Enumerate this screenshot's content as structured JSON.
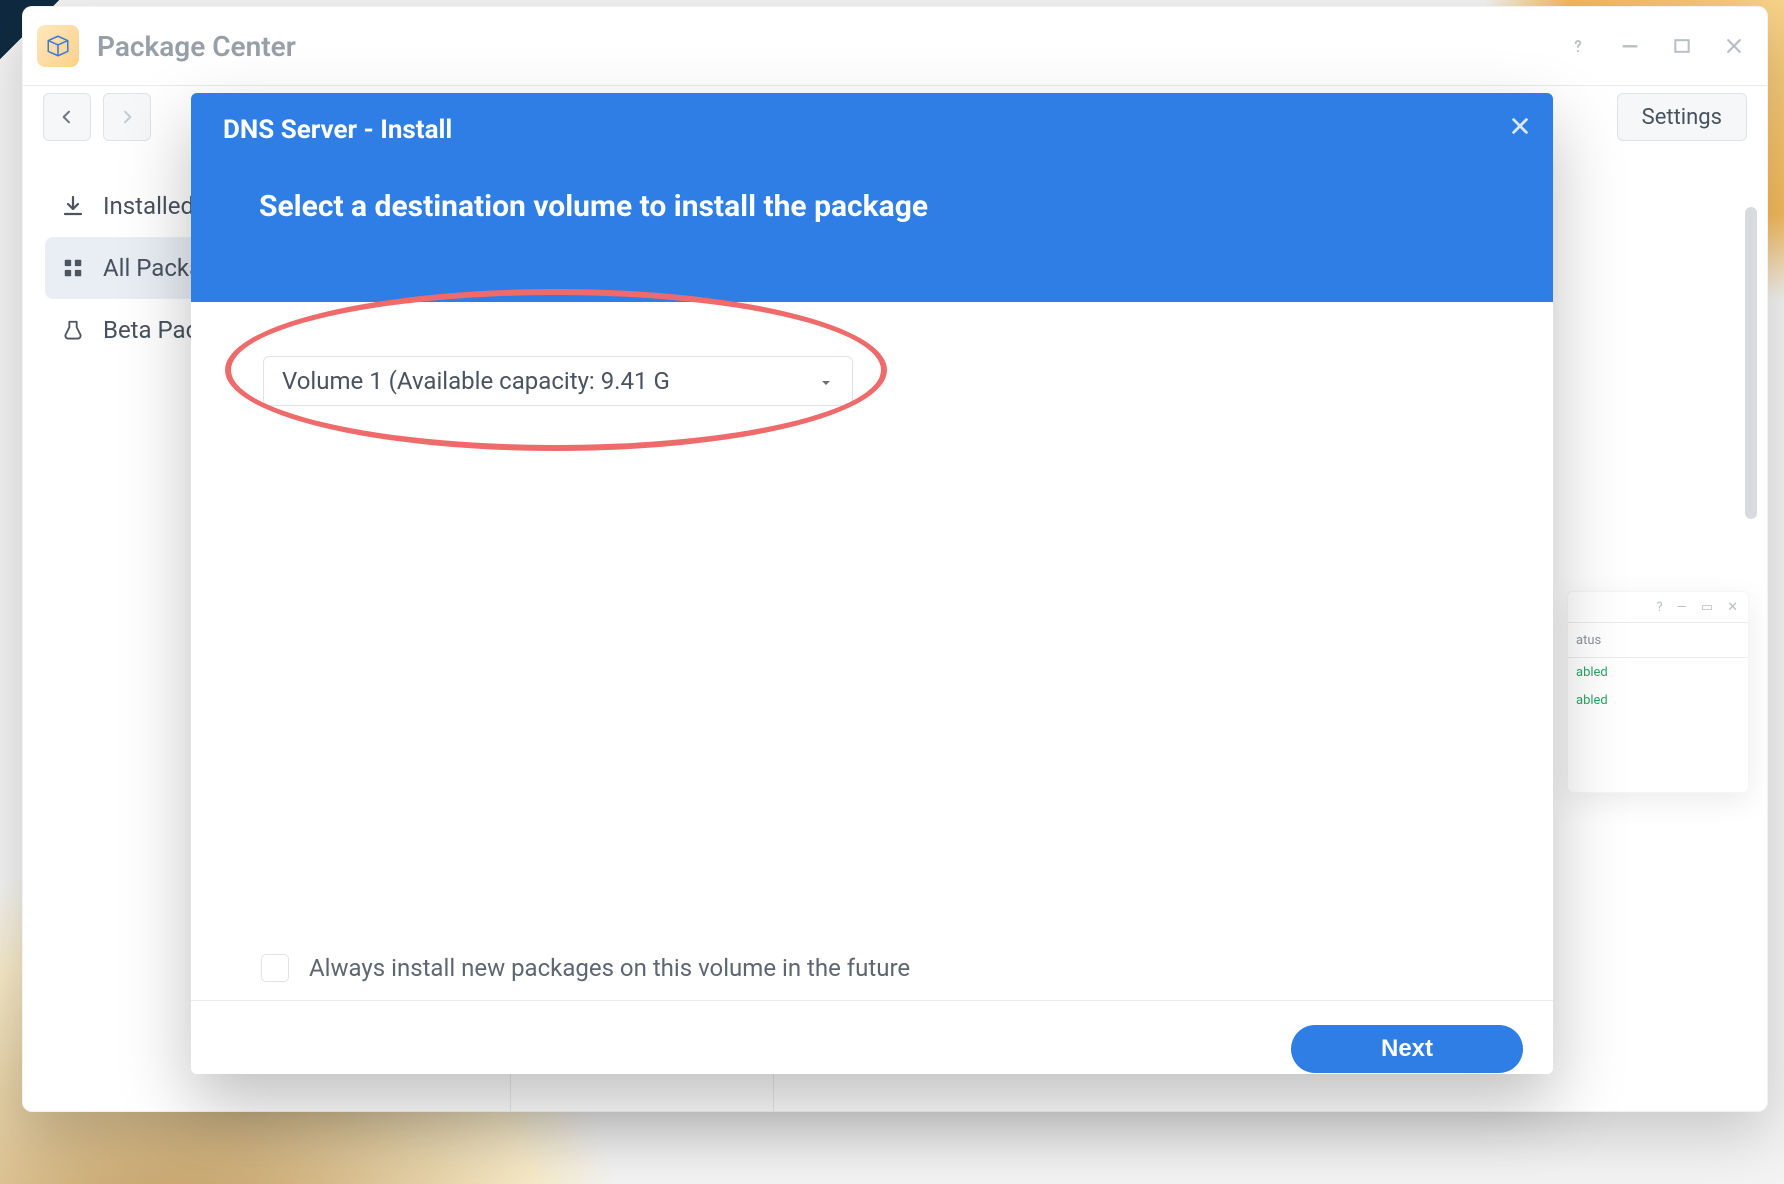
{
  "window": {
    "title": "Package Center",
    "toolbar": {
      "settings_label": "Settings"
    },
    "sidebar": {
      "items": [
        {
          "label": "Installed"
        },
        {
          "label": "All Packages"
        },
        {
          "label": "Beta Packages"
        }
      ],
      "selected_index": 1
    }
  },
  "modal": {
    "title": "DNS Server - Install",
    "subtitle": "Select a destination volume to install the package",
    "volume_select": {
      "text": "Volume 1 (Available capacity:  9.41 G"
    },
    "always_install_label": "Always install new packages on this volume in the future",
    "always_install_checked": false,
    "next_label": "Next"
  },
  "bg_window": {
    "header": {
      "status": "atus"
    },
    "rows": [
      {
        "status": "abled"
      },
      {
        "status": "abled"
      }
    ]
  }
}
